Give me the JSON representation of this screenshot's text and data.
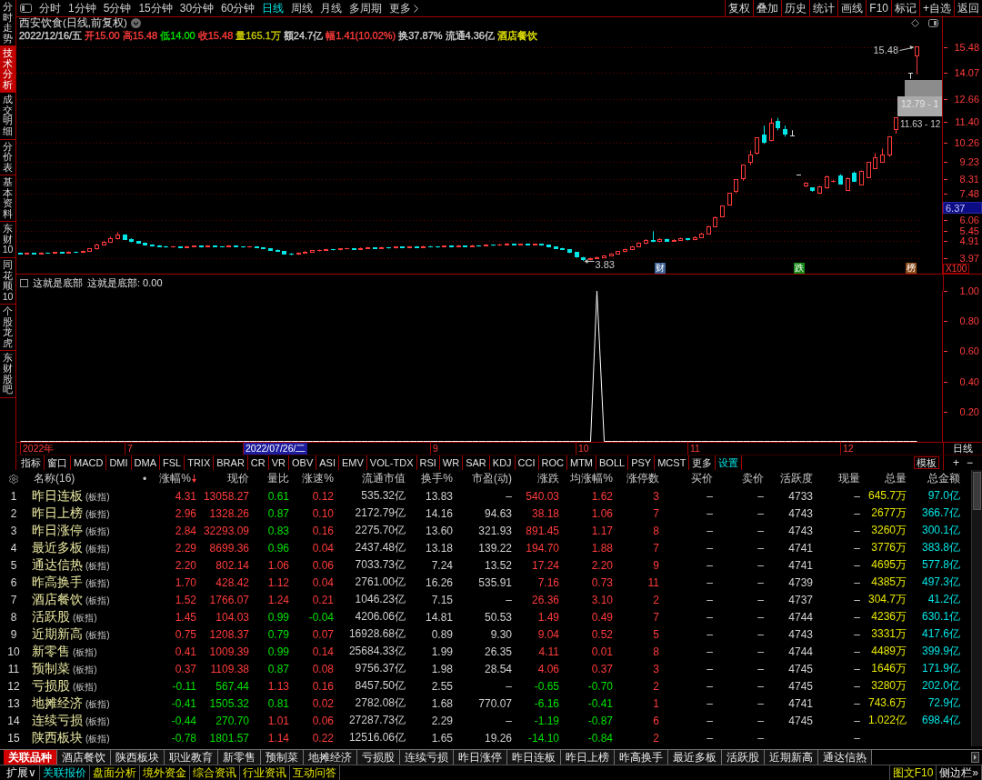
{
  "sidebar": {
    "tabs": [
      {
        "label": "分时走势",
        "selected": false
      },
      {
        "label": "技术分析",
        "selected": true
      },
      {
        "label": "成交明细",
        "selected": false
      },
      {
        "label": "分价表",
        "selected": false
      },
      {
        "label": "基本资料",
        "selected": false
      },
      {
        "label": "东财10",
        "selected": false
      },
      {
        "label": "同花顺10",
        "selected": false
      },
      {
        "label": "个股龙虎",
        "selected": false
      },
      {
        "label": "东财股吧",
        "selected": false
      }
    ]
  },
  "toolbar": {
    "periods": [
      {
        "label": "分时",
        "selected": false
      },
      {
        "label": "1分钟",
        "selected": false
      },
      {
        "label": "5分钟",
        "selected": false
      },
      {
        "label": "15分钟",
        "selected": false
      },
      {
        "label": "30分钟",
        "selected": false
      },
      {
        "label": "60分钟",
        "selected": false
      },
      {
        "label": "日线",
        "selected": true
      },
      {
        "label": "周线",
        "selected": false
      },
      {
        "label": "月线",
        "selected": false
      },
      {
        "label": "多周期",
        "selected": false
      }
    ],
    "more": "更多",
    "actions": [
      "复权",
      "叠加",
      "历史",
      "统计",
      "画线",
      "F10",
      "标记",
      "+自选",
      "返回"
    ]
  },
  "price_chart": {
    "title": "西安饮食(日线,前复权)",
    "quote": [
      {
        "text": "2022/12/16/五",
        "color": "#d0d0d0"
      },
      {
        "text": "开15.00",
        "color": "#ff3b3b"
      },
      {
        "text": "高15.48",
        "color": "#ff3b3b"
      },
      {
        "text": "低14.00",
        "color": "#00e000"
      },
      {
        "text": "收15.48",
        "color": "#ff3b3b"
      },
      {
        "text": "量165.1万",
        "color": "#c8c800"
      },
      {
        "text": "额24.7亿",
        "color": "#d0d0d0"
      },
      {
        "text": "幅1.41(10.02%)",
        "color": "#ff3b3b"
      },
      {
        "text": "换37.87%",
        "color": "#d0d0d0"
      },
      {
        "text": "流通4.36亿",
        "color": "#d0d0d0"
      },
      {
        "text": "酒店餐饮",
        "color": "#e6e600"
      }
    ],
    "high_label": "15.48",
    "low_label": "3.83",
    "overlay_labels": [
      "12.79 - 1",
      "11.63 - 12"
    ],
    "events": [
      {
        "label": "财",
        "color": "#3b5f95"
      },
      {
        "label": "跌",
        "color": "#168a16"
      },
      {
        "label": "榜",
        "color": "#8a4a1a"
      }
    ],
    "cursor_price": "6.37",
    "scale": "X100",
    "chart_data": {
      "type": "candlestick",
      "grid": true,
      "categories": [
        null,
        null,
        null,
        null,
        null,
        null,
        null,
        null,
        null,
        null,
        null,
        null,
        null,
        null,
        null,
        null,
        null,
        null,
        null,
        null,
        null,
        null,
        null,
        null,
        null,
        null,
        null,
        null,
        null,
        null,
        null,
        null,
        null,
        null,
        null,
        null,
        null,
        null,
        null,
        null,
        null,
        null,
        null,
        null,
        null,
        null,
        null,
        null,
        null,
        null,
        null,
        null,
        null,
        null,
        null,
        null,
        null,
        null,
        null,
        null,
        null,
        null,
        null,
        null,
        null,
        null,
        null,
        null,
        null,
        null,
        null,
        null,
        null,
        null,
        null,
        null,
        null,
        null,
        null,
        null,
        null,
        null,
        null,
        null,
        null,
        null,
        null,
        null,
        null,
        null,
        null,
        null,
        null,
        null,
        null,
        null,
        null,
        null,
        null,
        null,
        null,
        null,
        null,
        null,
        null,
        null,
        null,
        null,
        null,
        null,
        null,
        null,
        null,
        null,
        null,
        null,
        null,
        null,
        null,
        null,
        null,
        null,
        null,
        null,
        null,
        null,
        null,
        null,
        null,
        null
      ],
      "ohlc": [
        [
          4.25,
          4.28,
          4.19,
          4.22
        ],
        [
          4.22,
          4.29,
          4.2,
          4.25
        ],
        [
          4.25,
          4.28,
          4.18,
          4.21
        ],
        [
          4.21,
          4.3,
          4.19,
          4.26
        ],
        [
          4.26,
          4.29,
          4.22,
          4.24
        ],
        [
          4.24,
          4.32,
          4.21,
          4.28
        ],
        [
          4.28,
          4.31,
          4.24,
          4.27
        ],
        [
          4.27,
          4.35,
          4.25,
          4.31
        ],
        [
          4.31,
          4.34,
          4.26,
          4.29
        ],
        [
          4.29,
          4.39,
          4.27,
          4.35
        ],
        [
          4.35,
          4.52,
          4.33,
          4.48
        ],
        [
          4.48,
          4.76,
          4.45,
          4.7
        ],
        [
          4.7,
          4.93,
          4.66,
          4.85
        ],
        [
          4.85,
          5.15,
          4.82,
          5.05
        ],
        [
          5.05,
          5.4,
          5.0,
          5.22
        ],
        [
          5.22,
          5.28,
          4.98,
          5.02
        ],
        [
          5.02,
          5.06,
          4.84,
          4.88
        ],
        [
          4.88,
          4.92,
          4.76,
          4.8
        ],
        [
          4.8,
          4.83,
          4.66,
          4.7
        ],
        [
          4.7,
          4.74,
          4.62,
          4.66
        ],
        [
          4.66,
          4.69,
          4.59,
          4.62
        ],
        [
          4.62,
          4.65,
          4.55,
          4.58
        ],
        [
          4.58,
          4.64,
          4.56,
          4.6
        ],
        [
          4.6,
          4.62,
          4.53,
          4.56
        ],
        [
          4.56,
          4.65,
          4.54,
          4.61
        ],
        [
          4.61,
          4.67,
          4.58,
          4.63
        ],
        [
          4.63,
          4.66,
          4.56,
          4.59
        ],
        [
          4.59,
          4.69,
          4.57,
          4.65
        ],
        [
          4.65,
          4.68,
          4.59,
          4.62
        ],
        [
          4.62,
          4.64,
          4.57,
          4.6
        ],
        [
          4.6,
          4.68,
          4.58,
          4.64
        ],
        [
          4.64,
          4.67,
          4.58,
          4.61
        ],
        [
          4.61,
          4.63,
          4.55,
          4.58
        ],
        [
          4.58,
          4.64,
          4.56,
          4.6
        ],
        [
          4.6,
          4.62,
          4.52,
          4.55
        ],
        [
          4.55,
          4.57,
          4.47,
          4.5
        ],
        [
          4.5,
          4.52,
          4.39,
          4.42
        ],
        [
          4.42,
          4.45,
          4.32,
          4.35
        ],
        [
          4.35,
          4.37,
          4.19,
          4.22
        ],
        [
          4.22,
          4.25,
          4.14,
          4.18
        ],
        [
          4.18,
          4.29,
          4.16,
          4.25
        ],
        [
          4.25,
          4.36,
          4.23,
          4.32
        ],
        [
          4.32,
          4.42,
          4.3,
          4.38
        ],
        [
          4.38,
          4.45,
          4.35,
          4.41
        ],
        [
          4.41,
          4.49,
          4.39,
          4.45
        ],
        [
          4.45,
          4.48,
          4.4,
          4.43
        ],
        [
          4.43,
          4.52,
          4.41,
          4.48
        ],
        [
          4.48,
          4.54,
          4.46,
          4.5
        ],
        [
          4.5,
          4.53,
          4.44,
          4.47
        ],
        [
          4.47,
          4.56,
          4.45,
          4.52
        ],
        [
          4.52,
          4.59,
          4.5,
          4.55
        ],
        [
          4.55,
          4.58,
          4.48,
          4.51
        ],
        [
          4.51,
          4.6,
          4.49,
          4.56
        ],
        [
          4.56,
          4.59,
          4.5,
          4.53
        ],
        [
          4.53,
          4.62,
          4.51,
          4.58
        ],
        [
          4.58,
          4.61,
          4.52,
          4.55
        ],
        [
          4.55,
          4.64,
          4.53,
          4.6
        ],
        [
          4.6,
          4.63,
          4.54,
          4.57
        ],
        [
          4.57,
          4.66,
          4.55,
          4.62
        ],
        [
          4.62,
          4.65,
          4.57,
          4.6
        ],
        [
          4.6,
          4.63,
          4.55,
          4.58
        ],
        [
          4.58,
          4.67,
          4.56,
          4.63
        ],
        [
          4.63,
          4.66,
          4.57,
          4.6
        ],
        [
          4.6,
          4.69,
          4.58,
          4.65
        ],
        [
          4.65,
          4.68,
          4.59,
          4.62
        ],
        [
          4.62,
          4.7,
          4.6,
          4.66
        ],
        [
          4.66,
          4.69,
          4.61,
          4.64
        ],
        [
          4.64,
          4.74,
          4.62,
          4.7
        ],
        [
          4.7,
          4.73,
          4.65,
          4.68
        ],
        [
          4.68,
          4.76,
          4.66,
          4.72
        ],
        [
          4.72,
          4.8,
          4.7,
          4.75
        ],
        [
          4.75,
          4.78,
          4.68,
          4.71
        ],
        [
          4.71,
          4.78,
          4.69,
          4.74
        ],
        [
          4.74,
          4.77,
          4.67,
          4.7
        ],
        [
          4.7,
          4.77,
          4.68,
          4.73
        ],
        [
          4.73,
          4.76,
          4.66,
          4.69
        ],
        [
          4.69,
          4.71,
          4.57,
          4.6
        ],
        [
          4.6,
          4.62,
          4.49,
          4.52
        ],
        [
          4.52,
          4.55,
          4.42,
          4.45
        ],
        [
          4.45,
          4.47,
          4.25,
          4.28
        ],
        [
          4.28,
          4.3,
          4.01,
          4.05
        ],
        [
          4.02,
          4.05,
          3.83,
          3.9
        ],
        [
          3.9,
          4.01,
          3.87,
          3.98
        ],
        [
          3.98,
          4.06,
          3.97,
          4.02
        ],
        [
          4.02,
          4.14,
          4.0,
          4.1
        ],
        [
          4.1,
          4.25,
          4.08,
          4.21
        ],
        [
          4.21,
          4.37,
          4.19,
          4.33
        ],
        [
          4.33,
          4.5,
          4.3,
          4.45
        ],
        [
          4.45,
          4.65,
          4.42,
          4.6
        ],
        [
          4.6,
          4.84,
          4.57,
          4.78
        ],
        [
          4.78,
          5.02,
          4.75,
          4.95
        ],
        [
          4.95,
          5.45,
          4.85,
          4.88
        ],
        [
          4.88,
          5.08,
          4.85,
          5.02
        ],
        [
          5.02,
          5.05,
          4.89,
          4.92
        ],
        [
          4.92,
          5.01,
          4.9,
          4.97
        ],
        [
          4.97,
          5.1,
          4.95,
          5.05
        ],
        [
          5.05,
          5.08,
          4.95,
          4.98
        ],
        [
          4.98,
          5.18,
          4.96,
          5.12
        ],
        [
          5.12,
          5.36,
          5.1,
          5.3
        ],
        [
          5.3,
          5.75,
          5.28,
          5.68
        ],
        [
          5.7,
          6.25,
          5.66,
          6.2
        ],
        [
          6.25,
          6.82,
          6.2,
          6.82
        ],
        [
          6.9,
          7.5,
          6.85,
          7.5
        ],
        [
          7.6,
          8.25,
          7.52,
          8.25
        ],
        [
          8.3,
          9.08,
          8.2,
          9.08
        ],
        [
          9.2,
          9.85,
          9.05,
          9.6
        ],
        [
          9.7,
          10.56,
          9.62,
          10.56
        ],
        [
          10.7,
          11.2,
          10.2,
          10.3
        ],
        [
          10.4,
          11.6,
          10.35,
          11.35
        ],
        [
          11.45,
          11.62,
          10.95,
          11.1
        ],
        [
          11.0,
          11.2,
          10.6,
          10.75
        ],
        [
          10.62,
          10.95,
          10.62,
          10.62
        ],
        [
          8.49,
          8.49,
          8.49,
          8.49
        ],
        [
          7.92,
          8.12,
          7.85,
          8.08
        ],
        [
          7.8,
          7.84,
          7.6,
          7.66
        ],
        [
          7.52,
          7.92,
          7.48,
          7.88
        ],
        [
          7.8,
          8.48,
          7.76,
          8.43
        ],
        [
          8.16,
          8.25,
          8.1,
          8.18
        ],
        [
          8.48,
          8.55,
          8.0,
          8.03
        ],
        [
          7.69,
          8.38,
          7.65,
          8.33
        ],
        [
          8.62,
          8.7,
          8.15,
          8.18
        ],
        [
          7.98,
          8.76,
          7.95,
          8.72
        ],
        [
          8.38,
          9.22,
          8.35,
          9.18
        ],
        [
          8.88,
          9.7,
          8.85,
          9.47
        ],
        [
          9.22,
          9.95,
          9.18,
          9.6
        ],
        [
          9.62,
          10.57,
          9.5,
          10.57
        ],
        [
          11.0,
          11.63,
          10.76,
          11.63
        ],
        null,
        [
          14.07,
          14.07,
          13.75,
          14.07
        ],
        [
          15.0,
          15.48,
          14.0,
          15.48
        ]
      ],
      "ylim": [
        3.14,
        17.15
      ],
      "yticks": [
        {
          "value": 15.48,
          "label": "15.48"
        },
        {
          "value": 14.07,
          "label": "14.07"
        },
        {
          "value": 12.66,
          "label": "12.66"
        },
        {
          "value": 11.4,
          "label": "11.40"
        },
        {
          "value": 10.26,
          "label": "10.26"
        },
        {
          "value": 9.23,
          "label": "9.23"
        },
        {
          "value": 8.31,
          "label": "8.31"
        },
        {
          "value": 7.48,
          "label": "7.48"
        },
        {
          "value": 6.06,
          "label": "6.06"
        },
        {
          "value": 5.45,
          "label": "5.45"
        },
        {
          "value": 4.91,
          "label": "4.91"
        },
        {
          "value": 3.97,
          "label": "3.97"
        }
      ]
    }
  },
  "indicator": {
    "legend": "这就是底部: 0.00",
    "chart_data": {
      "type": "line",
      "title": "这就是底部",
      "series": [
        {
          "color": "#ffffff",
          "values": [
            0,
            0,
            0,
            0,
            0,
            0,
            0,
            0,
            0,
            0,
            0,
            0,
            0,
            0,
            0,
            0,
            0,
            0,
            0,
            0,
            0,
            0,
            0,
            0,
            0,
            0,
            0,
            0,
            0,
            0,
            0,
            0,
            0,
            0,
            0,
            0,
            0,
            0,
            0,
            0,
            0,
            0,
            0,
            0,
            0,
            0,
            0,
            0,
            0,
            0,
            0,
            0,
            0,
            0,
            0,
            0,
            0,
            0,
            0,
            0,
            0,
            0,
            0,
            0,
            0,
            0,
            0,
            0,
            0,
            0,
            0,
            0,
            0,
            0,
            0,
            0,
            0,
            0,
            0,
            0,
            0,
            0,
            0,
            1,
            0,
            0,
            0,
            0,
            0,
            0,
            0,
            0,
            0,
            0,
            0,
            0,
            0,
            0,
            0,
            0,
            0,
            0,
            0,
            0,
            0,
            0,
            0,
            0,
            0,
            0,
            0,
            0,
            0,
            0,
            0,
            0,
            0,
            0,
            0,
            0,
            0,
            0,
            0,
            0,
            0,
            0,
            0,
            0,
            0,
            0
          ]
        }
      ],
      "ylim": [
        0,
        1
      ],
      "yticks": [
        {
          "value": 1,
          "label": "1.00"
        },
        {
          "value": 0.8,
          "label": "0.80"
        },
        {
          "value": 0.6,
          "label": "0.60"
        },
        {
          "value": 0.4,
          "label": "0.40"
        },
        {
          "value": 0.2,
          "label": "0.20"
        }
      ]
    }
  },
  "date_axis": {
    "labels": [
      "2022年",
      "7",
      "9",
      "10",
      "11",
      "12"
    ],
    "cursor_date": "2022/07/26/二",
    "period": "日线"
  },
  "indicator_bar": {
    "tabs": [
      "指标",
      "窗口",
      "MACD",
      "DMI",
      "DMA",
      "FSL",
      "TRIX",
      "BRAR",
      "CR",
      "VR",
      "OBV",
      "ASI",
      "EMV",
      "VOL-TDX",
      "RSI",
      "WR",
      "SAR",
      "KDJ",
      "CCI",
      "ROC",
      "MTM",
      "BOLL",
      "PSY",
      "MCST",
      "更多"
    ],
    "settings": "设置",
    "template": "模板",
    "add": "+",
    "remove": "−"
  },
  "table": {
    "columns": [
      {
        "label": "名称(16)",
        "sorted": false
      },
      {
        "label": "•",
        "sorted": false
      },
      {
        "label": "涨幅%",
        "sorted": true
      },
      {
        "label": "现价",
        "sorted": false
      },
      {
        "label": "量比",
        "sorted": false
      },
      {
        "label": "涨速%",
        "sorted": false
      },
      {
        "label": "流通市值",
        "sorted": false
      },
      {
        "label": "换手%",
        "sorted": false
      },
      {
        "label": "市盈(动)",
        "sorted": false
      },
      {
        "label": "涨跌",
        "sorted": false
      },
      {
        "label": "均涨幅%",
        "sorted": false
      },
      {
        "label": "涨停数",
        "sorted": false
      },
      {
        "label": "买价",
        "sorted": false
      },
      {
        "label": "卖价",
        "sorted": false
      },
      {
        "label": "活跃度",
        "sorted": false
      },
      {
        "label": "现量",
        "sorted": false
      },
      {
        "label": "总量",
        "sorted": false
      },
      {
        "label": "总金额",
        "sorted": false
      }
    ],
    "rows": [
      {
        "rank": "1",
        "name": "昨日连板",
        "tag": "(板指)",
        "change_pct": "4.31",
        "price": "13058.27",
        "volume_ratio": "0.61",
        "speed": "0.12",
        "float_cap": "535.32亿",
        "turnover": "13.83",
        "pe": "–",
        "change": "540.03",
        "avg_change": "1.62",
        "limit_ups": "3",
        "bid": "–",
        "ask": "–",
        "activity": "4733",
        "last_volume": "–",
        "volume": "645.7万",
        "amount": "97.0亿",
        "rising": true,
        "volume_ratio_high": false,
        "speed_rising": true
      },
      {
        "rank": "2",
        "name": "昨日上榜",
        "tag": "(板指)",
        "change_pct": "2.96",
        "price": "1328.26",
        "volume_ratio": "0.87",
        "speed": "0.10",
        "float_cap": "2172.79亿",
        "turnover": "14.16",
        "pe": "94.63",
        "change": "38.18",
        "avg_change": "1.06",
        "limit_ups": "7",
        "bid": "–",
        "ask": "–",
        "activity": "4743",
        "last_volume": "–",
        "volume": "2677万",
        "amount": "366.7亿",
        "rising": true,
        "volume_ratio_high": false,
        "speed_rising": true
      },
      {
        "rank": "3",
        "name": "昨日涨停",
        "tag": "(板指)",
        "change_pct": "2.84",
        "price": "32293.09",
        "volume_ratio": "0.83",
        "speed": "0.16",
        "float_cap": "2275.70亿",
        "turnover": "13.60",
        "pe": "321.93",
        "change": "891.45",
        "avg_change": "1.17",
        "limit_ups": "8",
        "bid": "–",
        "ask": "–",
        "activity": "4743",
        "last_volume": "–",
        "volume": "3260万",
        "amount": "300.1亿",
        "rising": true,
        "volume_ratio_high": false,
        "speed_rising": true
      },
      {
        "rank": "4",
        "name": "最近多板",
        "tag": "(板指)",
        "change_pct": "2.29",
        "price": "8699.36",
        "volume_ratio": "0.96",
        "speed": "0.04",
        "float_cap": "2437.48亿",
        "turnover": "13.18",
        "pe": "139.22",
        "change": "194.70",
        "avg_change": "1.88",
        "limit_ups": "7",
        "bid": "–",
        "ask": "–",
        "activity": "4741",
        "last_volume": "–",
        "volume": "3776万",
        "amount": "383.8亿",
        "rising": true,
        "volume_ratio_high": false,
        "speed_rising": true
      },
      {
        "rank": "5",
        "name": "通达信热",
        "tag": "(板指)",
        "change_pct": "2.20",
        "price": "802.14",
        "volume_ratio": "1.06",
        "speed": "0.06",
        "float_cap": "7033.73亿",
        "turnover": "7.24",
        "pe": "13.52",
        "change": "17.24",
        "avg_change": "2.20",
        "limit_ups": "9",
        "bid": "–",
        "ask": "–",
        "activity": "4741",
        "last_volume": "–",
        "volume": "4695万",
        "amount": "577.8亿",
        "rising": true,
        "volume_ratio_high": true,
        "speed_rising": true
      },
      {
        "rank": "6",
        "name": "昨高换手",
        "tag": "(板指)",
        "change_pct": "1.70",
        "price": "428.42",
        "volume_ratio": "1.12",
        "speed": "0.04",
        "float_cap": "2761.00亿",
        "turnover": "16.26",
        "pe": "535.91",
        "change": "7.16",
        "avg_change": "0.73",
        "limit_ups": "11",
        "bid": "–",
        "ask": "–",
        "activity": "4739",
        "last_volume": "–",
        "volume": "4385万",
        "amount": "497.3亿",
        "rising": true,
        "volume_ratio_high": true,
        "speed_rising": true
      },
      {
        "rank": "7",
        "name": "酒店餐饮",
        "tag": "(板指)",
        "change_pct": "1.52",
        "price": "1766.07",
        "volume_ratio": "1.24",
        "speed": "0.21",
        "float_cap": "1046.23亿",
        "turnover": "7.15",
        "pe": "–",
        "change": "26.36",
        "avg_change": "3.10",
        "limit_ups": "2",
        "bid": "–",
        "ask": "–",
        "activity": "4737",
        "last_volume": "–",
        "volume": "304.7万",
        "amount": "41.2亿",
        "rising": true,
        "volume_ratio_high": true,
        "speed_rising": true
      },
      {
        "rank": "8",
        "name": "活跃股",
        "tag": "(板指)",
        "change_pct": "1.45",
        "price": "104.03",
        "volume_ratio": "0.99",
        "speed": "-0.04",
        "float_cap": "4206.06亿",
        "turnover": "14.81",
        "pe": "50.53",
        "change": "1.49",
        "avg_change": "0.49",
        "limit_ups": "7",
        "bid": "–",
        "ask": "–",
        "activity": "4744",
        "last_volume": "–",
        "volume": "4236万",
        "amount": "630.1亿",
        "rising": true,
        "volume_ratio_high": false,
        "speed_rising": false
      },
      {
        "rank": "9",
        "name": "近期新高",
        "tag": "(板指)",
        "change_pct": "0.75",
        "price": "1208.37",
        "volume_ratio": "0.79",
        "speed": "0.07",
        "float_cap": "16928.68亿",
        "turnover": "0.89",
        "pe": "9.30",
        "change": "9.04",
        "avg_change": "0.52",
        "limit_ups": "5",
        "bid": "–",
        "ask": "–",
        "activity": "4743",
        "last_volume": "–",
        "volume": "3331万",
        "amount": "417.6亿",
        "rising": true,
        "volume_ratio_high": false,
        "speed_rising": true
      },
      {
        "rank": "10",
        "name": "新零售",
        "tag": "(板指)",
        "change_pct": "0.41",
        "price": "1009.39",
        "volume_ratio": "0.99",
        "speed": "0.14",
        "float_cap": "25684.33亿",
        "turnover": "1.99",
        "pe": "26.35",
        "change": "4.11",
        "avg_change": "0.01",
        "limit_ups": "8",
        "bid": "–",
        "ask": "–",
        "activity": "4744",
        "last_volume": "–",
        "volume": "4489万",
        "amount": "399.9亿",
        "rising": true,
        "volume_ratio_high": false,
        "speed_rising": true
      },
      {
        "rank": "11",
        "name": "预制菜",
        "tag": "(板指)",
        "change_pct": "0.37",
        "price": "1109.38",
        "volume_ratio": "0.87",
        "speed": "0.08",
        "float_cap": "9756.37亿",
        "turnover": "1.98",
        "pe": "28.54",
        "change": "4.06",
        "avg_change": "0.37",
        "limit_ups": "3",
        "bid": "–",
        "ask": "–",
        "activity": "4745",
        "last_volume": "–",
        "volume": "1646万",
        "amount": "171.9亿",
        "rising": true,
        "volume_ratio_high": false,
        "speed_rising": true
      },
      {
        "rank": "12",
        "name": "亏损股",
        "tag": "(板指)",
        "change_pct": "-0.11",
        "price": "567.44",
        "volume_ratio": "1.13",
        "speed": "0.16",
        "float_cap": "8457.50亿",
        "turnover": "2.55",
        "pe": "–",
        "change": "-0.65",
        "avg_change": "-0.70",
        "limit_ups": "2",
        "bid": "–",
        "ask": "–",
        "activity": "4745",
        "last_volume": "–",
        "volume": "3280万",
        "amount": "202.0亿",
        "rising": false,
        "volume_ratio_high": true,
        "speed_rising": true
      },
      {
        "rank": "13",
        "name": "地摊经济",
        "tag": "(板指)",
        "change_pct": "-0.41",
        "price": "1505.32",
        "volume_ratio": "0.81",
        "speed": "0.02",
        "float_cap": "2782.08亿",
        "turnover": "1.68",
        "pe": "770.07",
        "change": "-6.16",
        "avg_change": "-0.41",
        "limit_ups": "1",
        "bid": "–",
        "ask": "–",
        "activity": "4741",
        "last_volume": "–",
        "volume": "743.6万",
        "amount": "72.9亿",
        "rising": false,
        "volume_ratio_high": false,
        "speed_rising": true
      },
      {
        "rank": "14",
        "name": "连续亏损",
        "tag": "(板指)",
        "change_pct": "-0.44",
        "price": "270.70",
        "volume_ratio": "1.01",
        "speed": "0.06",
        "float_cap": "27287.73亿",
        "turnover": "2.29",
        "pe": "–",
        "change": "-1.19",
        "avg_change": "-0.87",
        "limit_ups": "6",
        "bid": "–",
        "ask": "–",
        "activity": "4745",
        "last_volume": "–",
        "volume": "1.022亿",
        "amount": "698.4亿",
        "rising": false,
        "volume_ratio_high": true,
        "speed_rising": true
      },
      {
        "rank": "15",
        "name": "陕西板块",
        "tag": "(板指)",
        "change_pct": "-0.78",
        "price": "1801.57",
        "volume_ratio": "1.14",
        "speed": "0.22",
        "float_cap": "12516.06亿",
        "turnover": "1.65",
        "pe": "19.26",
        "change": "-14.10",
        "avg_change": "-0.84",
        "limit_ups": "2",
        "bid": "–",
        "ask": "–",
        "last_volume": "–",
        "rising": false,
        "volume_ratio_high": true,
        "speed_rising": true
      }
    ]
  },
  "bottom_tabs": [
    {
      "label": "关联品种",
      "selected": true
    },
    {
      "label": "酒店餐饮",
      "selected": false
    },
    {
      "label": "陕西板块",
      "selected": false
    },
    {
      "label": "职业教育",
      "selected": false
    },
    {
      "label": "新零售",
      "selected": false
    },
    {
      "label": "预制菜",
      "selected": false
    },
    {
      "label": "地摊经济",
      "selected": false
    },
    {
      "label": "亏损股",
      "selected": false
    },
    {
      "label": "连续亏损",
      "selected": false
    },
    {
      "label": "昨日涨停",
      "selected": false
    },
    {
      "label": "昨日连板",
      "selected": false
    },
    {
      "label": "昨日上榜",
      "selected": false
    },
    {
      "label": "昨高换手",
      "selected": false
    },
    {
      "label": "最近多板",
      "selected": false
    },
    {
      "label": "活跃股",
      "selected": false
    },
    {
      "label": "近期新高",
      "selected": false
    },
    {
      "label": "通达信热",
      "selected": false
    }
  ],
  "status_bar": {
    "expand": "扩展∨",
    "tabs": [
      {
        "label": "关联报价",
        "selected": true
      },
      {
        "label": "盘面分析",
        "selected": false
      },
      {
        "label": "境外资金",
        "selected": false
      },
      {
        "label": "综合资讯",
        "selected": false
      },
      {
        "label": "行业资讯",
        "selected": false
      },
      {
        "label": "互动问答",
        "selected": false
      }
    ],
    "f10": "图文F10",
    "sidebar_toggle": "侧边栏»"
  }
}
